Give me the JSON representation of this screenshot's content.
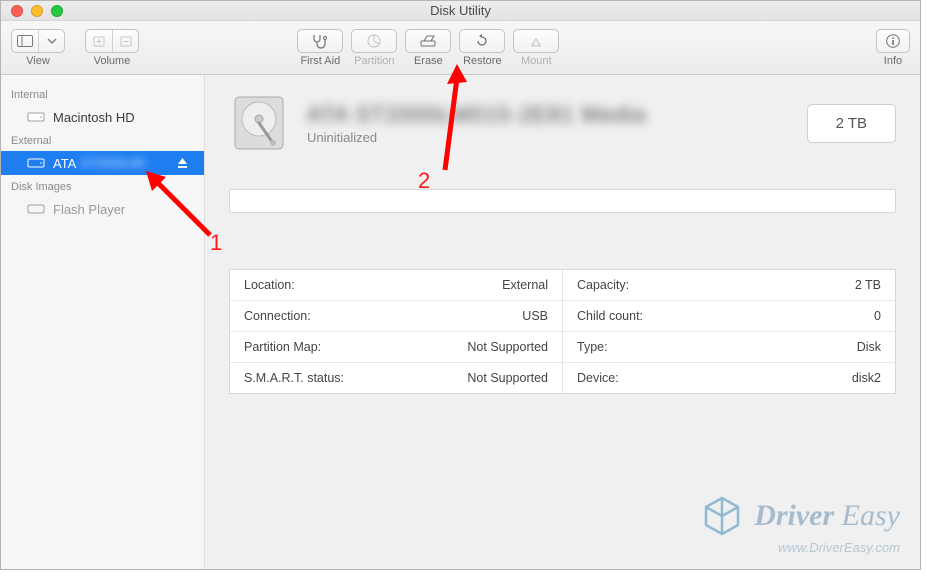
{
  "window": {
    "title": "Disk Utility"
  },
  "toolbar": {
    "view_label": "View",
    "volume_label": "Volume",
    "info_label": "Info",
    "items": [
      {
        "id": "first-aid",
        "label": "First Aid"
      },
      {
        "id": "partition",
        "label": "Partition"
      },
      {
        "id": "erase",
        "label": "Erase"
      },
      {
        "id": "restore",
        "label": "Restore"
      },
      {
        "id": "mount",
        "label": "Mount"
      }
    ]
  },
  "sidebar": {
    "sections": [
      {
        "header": "Internal",
        "items": [
          {
            "label": "Macintosh HD",
            "selected": false
          }
        ]
      },
      {
        "header": "External",
        "items": [
          {
            "label": "ATA",
            "selected": true,
            "ejectable": true
          }
        ]
      },
      {
        "header": "Disk Images",
        "items": [
          {
            "label": "Flash Player",
            "dim": true
          }
        ]
      }
    ]
  },
  "disk": {
    "title_redacted": "ATA ST2000LM015-2E81 Media",
    "subtitle": "Uninitialized",
    "capacity_button": "2 TB"
  },
  "details": {
    "left": [
      {
        "k": "Location:",
        "v": "External"
      },
      {
        "k": "Connection:",
        "v": "USB"
      },
      {
        "k": "Partition Map:",
        "v": "Not Supported"
      },
      {
        "k": "S.M.A.R.T. status:",
        "v": "Not Supported"
      }
    ],
    "right": [
      {
        "k": "Capacity:",
        "v": "2 TB"
      },
      {
        "k": "Child count:",
        "v": "0"
      },
      {
        "k": "Type:",
        "v": "Disk"
      },
      {
        "k": "Device:",
        "v": "disk2"
      }
    ]
  },
  "annotations": {
    "one": "1",
    "two": "2"
  },
  "watermark": {
    "brand_a": "Driver",
    "brand_b": "Easy",
    "url": "www.DriverEasy.com"
  }
}
